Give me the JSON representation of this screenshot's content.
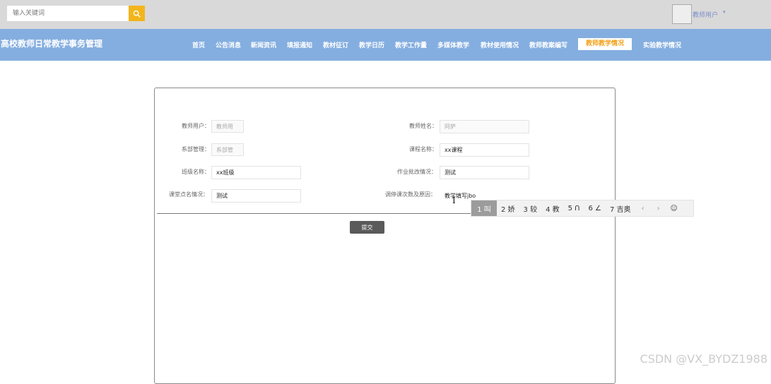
{
  "search": {
    "placeholder": "输入关键词"
  },
  "user": {
    "name": "教师用户",
    "caret": "▾"
  },
  "site": {
    "title": "高校教师日常教学事务管理"
  },
  "nav": {
    "items": [
      {
        "label": "首页"
      },
      {
        "label": "公告消息"
      },
      {
        "label": "新闻资讯"
      },
      {
        "label": "填报通知"
      },
      {
        "label": "教材征订"
      },
      {
        "label": "教学日历"
      },
      {
        "label": "教学工作量"
      },
      {
        "label": "多媒体教学"
      },
      {
        "label": "教材使用情况"
      },
      {
        "label": "教师教案编写"
      },
      {
        "label": "教师教学情况"
      },
      {
        "label": "实验教学情况"
      }
    ],
    "active_index": 10
  },
  "form": {
    "teacher_account": {
      "label": "教师用户：",
      "value": "教师用"
    },
    "teacher_name": {
      "label": "教师姓名：",
      "value": "阿萨"
    },
    "department": {
      "label": "系部管理：",
      "value": "系部管"
    },
    "course_name": {
      "label": "课程名称：",
      "value": "xx课程"
    },
    "class_name": {
      "label": "班级名称：",
      "value": "xx班级"
    },
    "homework": {
      "label": "作业批改情况：",
      "value": "测试"
    },
    "roll_call": {
      "label": "课堂点名情况：",
      "value": "测试"
    },
    "class_change": {
      "label": "调停课次数及原因：",
      "value": "教学填写jbo"
    },
    "submit_label": "提交"
  },
  "ime": {
    "candidates": [
      "1 叫",
      "2 娇",
      "3 较",
      "4 教",
      "5 Ո",
      "6 ∠",
      "7 吉奥"
    ],
    "prev": "‹",
    "next": "›",
    "emoji": "☺"
  },
  "watermark": "CSDN @VX_BYDZ1988"
}
